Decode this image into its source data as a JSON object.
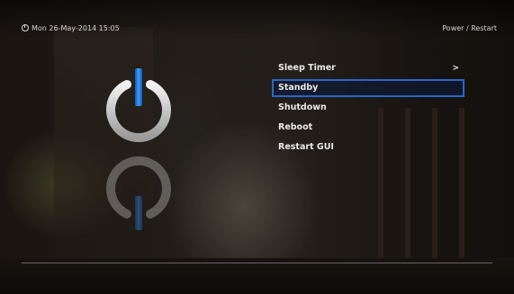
{
  "header": {
    "datetime": "Mon 26-May-2014 15:05",
    "title": "Power / Restart",
    "clock_icon": "clock-icon"
  },
  "menu": {
    "items": [
      {
        "label": "Sleep Timer",
        "arrow": ">"
      },
      {
        "label": "Standby"
      },
      {
        "label": "Shutdown"
      },
      {
        "label": "Reboot"
      },
      {
        "label": "Restart GUI"
      }
    ],
    "selected_index": 1
  },
  "icons": {
    "top": "power-icon",
    "bottom": "power-icon-reflection"
  },
  "colors": {
    "accent": "#2a66c9",
    "power_bar": "#2f8cff",
    "power_ring": "#d0d0d0",
    "text": "#eaeaea"
  }
}
